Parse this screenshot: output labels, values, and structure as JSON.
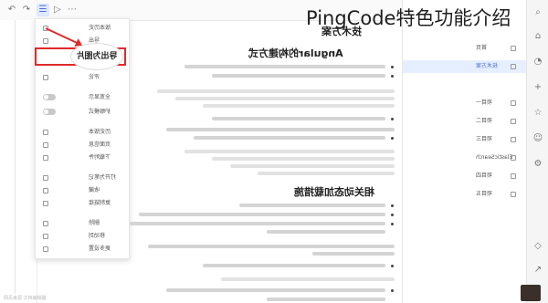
{
  "overlay_title": "PingCode特色功能介绍",
  "toolbar": {
    "icons": [
      "undo-icon",
      "redo-icon",
      "outline-icon",
      "play-icon",
      "more-icon"
    ]
  },
  "context_menu": {
    "highlighted_item": "导出为图片",
    "items": [
      "版本历史",
      "导出",
      "导出为图片",
      "评论",
      "全宽显示",
      "护眼模式",
      "历史版本",
      "页面信息",
      "下载附件",
      "打开为笔记",
      "收藏",
      "复制链接",
      "删除",
      "移动到",
      "更多设置"
    ]
  },
  "document": {
    "top_heading": "技术方案",
    "section_heading_1": "Angular的构建方式",
    "section_heading_2": "相关动态加载措施"
  },
  "right_panel": {
    "items": [
      "首页",
      "技术方案",
      "项目一",
      "项目二",
      "项目三",
      "ElasticSearch",
      "项目四",
      "项目五"
    ],
    "selected_index": 1
  },
  "rail": {
    "icons": [
      "search-icon",
      "home-icon",
      "bell-icon",
      "add-icon",
      "star-icon",
      "user-icon",
      "settings-icon",
      "cube-icon",
      "share-icon",
      "help-icon"
    ]
  },
  "status_text": "网页来源 文档编辑器"
}
